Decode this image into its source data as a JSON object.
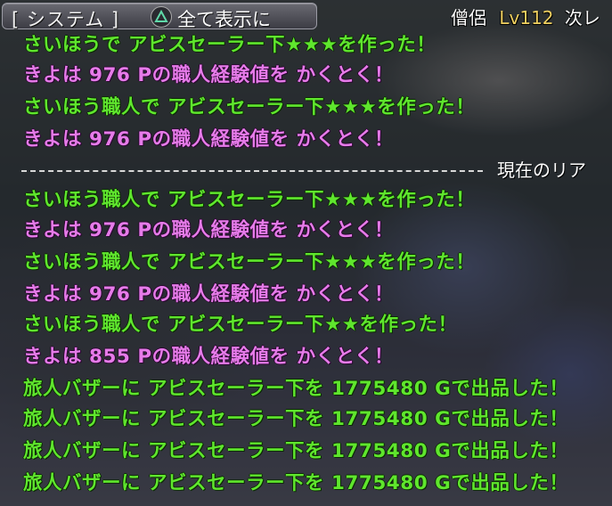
{
  "tab": {
    "label": "[ システム ]",
    "action": "全て表示に"
  },
  "status": {
    "job": "僧侶",
    "level": "Lv112",
    "next": "次レ"
  },
  "log": {
    "group1": [
      {
        "text": "さいほうで アビスセーラー下★★★を作った！",
        "color": "green"
      },
      {
        "text": "きよは 976 Pの職人経験値を かくとく！",
        "color": "pink"
      },
      {
        "text": "さいほう職人で アビスセーラー下★★★を作った！",
        "color": "green"
      },
      {
        "text": "きよは 976 Pの職人経験値を かくとく！",
        "color": "pink"
      }
    ],
    "divider": "現在のリア",
    "group2": [
      {
        "text": "さいほう職人で アビスセーラー下★★★を作った！",
        "color": "green"
      },
      {
        "text": "きよは 976 Pの職人経験値を かくとく！",
        "color": "pink"
      },
      {
        "text": "さいほう職人で アビスセーラー下★★★を作った！",
        "color": "green"
      },
      {
        "text": "きよは 976 Pの職人経験値を かくとく！",
        "color": "pink"
      },
      {
        "text": "さいほう職人で アビスセーラー下★★を作った！",
        "color": "green"
      },
      {
        "text": "きよは 855 Pの職人経験値を かくとく！",
        "color": "pink"
      },
      {
        "text": "旅人バザーに アビスセーラー下を 1775480 Gで出品した！",
        "color": "green"
      },
      {
        "text": "旅人バザーに アビスセーラー下を 1775480 Gで出品した！",
        "color": "green"
      },
      {
        "text": "旅人バザーに アビスセーラー下を 1775480 Gで出品した！",
        "color": "green"
      },
      {
        "text": "旅人バザーに アビスセーラー下を 1775480 Gで出品した！",
        "color": "green"
      }
    ]
  },
  "icons": {
    "triangle_button": "triangle-button-icon"
  }
}
